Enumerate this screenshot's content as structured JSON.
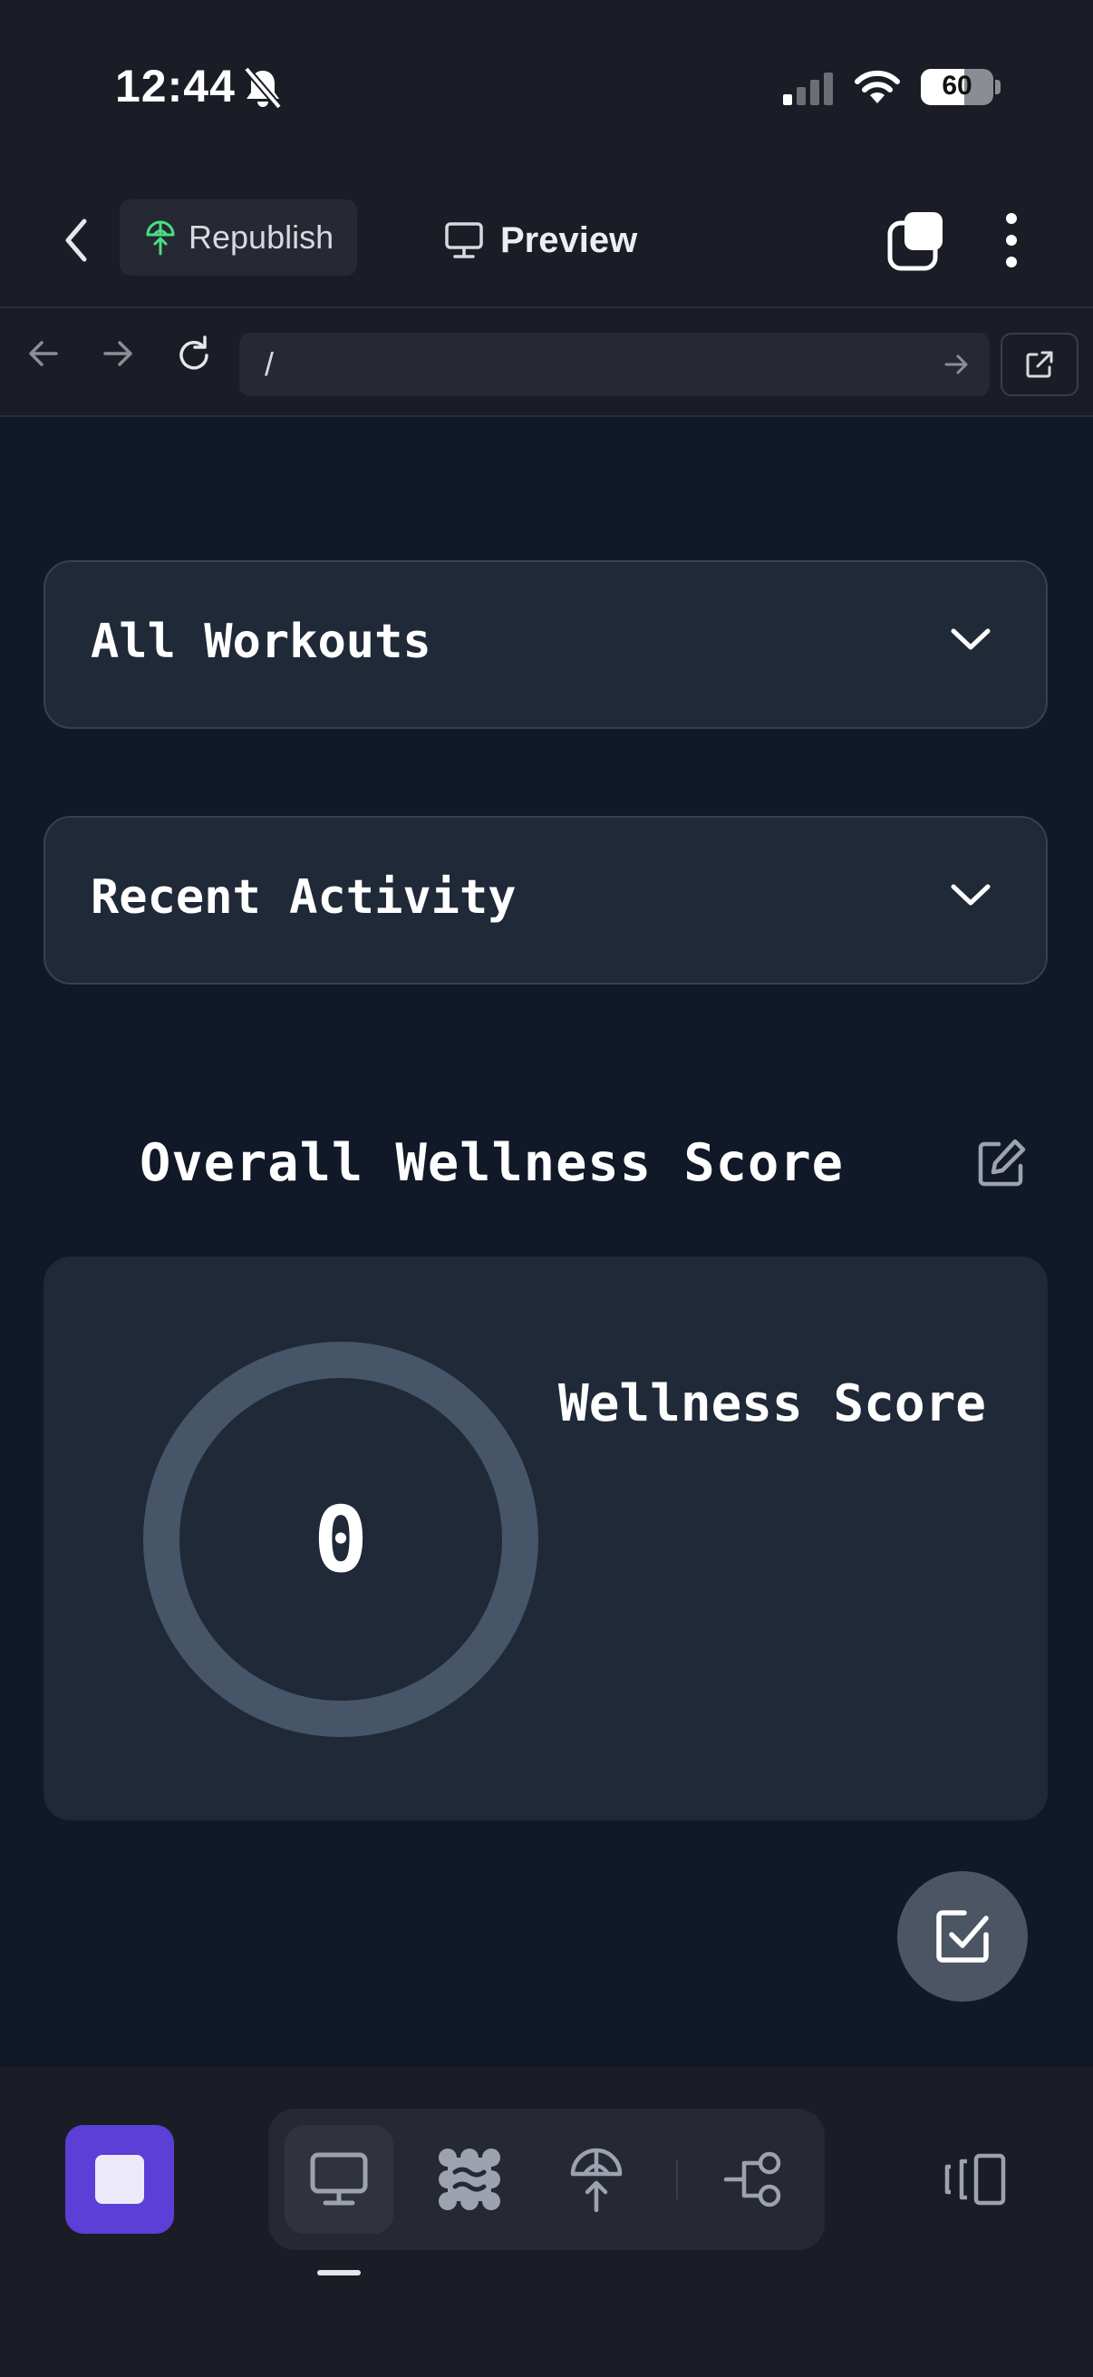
{
  "status_bar": {
    "time": "12:44",
    "battery": "60"
  },
  "toolbar": {
    "republish_label": "Republish",
    "preview_label": "Preview"
  },
  "url_bar": {
    "path": "/"
  },
  "dropdowns": [
    {
      "label": "All Workouts"
    },
    {
      "label": "Recent Activity"
    }
  ],
  "wellness": {
    "section_title": "Overall Wellness Score",
    "score_label": "Wellness Score",
    "score_value": "0"
  },
  "colors": {
    "background": "#111827",
    "card": "#1f2937",
    "ring": "#4b5563",
    "accent": "#5b3fd6",
    "republish_icon": "#4ade80"
  },
  "icons": [
    "mute-bell-icon",
    "signal-icon",
    "wifi-icon",
    "back-chevron-icon",
    "republish-icon",
    "monitor-icon",
    "tabs-icon",
    "more-vertical-icon",
    "arrow-left-icon",
    "arrow-right-icon",
    "reload-icon",
    "go-arrow-icon",
    "open-external-icon",
    "chevron-down-icon",
    "edit-icon",
    "checkbox-icon",
    "stop-icon",
    "desktop-icon",
    "assets-icon",
    "deploy-icon",
    "flow-icon",
    "device-icon"
  ]
}
